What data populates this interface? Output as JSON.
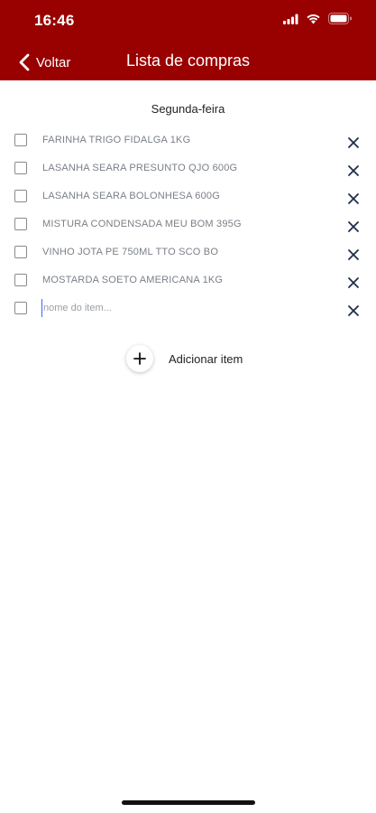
{
  "status_bar": {
    "time": "16:46",
    "icons": [
      "signal-icon",
      "wifi-icon",
      "battery-icon"
    ]
  },
  "header": {
    "back_label": "Voltar",
    "title": "Lista de compras",
    "background_color": "#990000"
  },
  "list": {
    "day": "Segunda-feira",
    "items": [
      {
        "label": "FARINHA TRIGO FIDALGA 1KG",
        "checked": false
      },
      {
        "label": "LASANHA SEARA PRESUNTO QJO 600G",
        "checked": false
      },
      {
        "label": "LASANHA SEARA BOLONHESA 600G",
        "checked": false
      },
      {
        "label": "MISTURA CONDENSADA MEU BOM 395G",
        "checked": false
      },
      {
        "label": "VINHO JOTA PE 750ML TTO SCO BO",
        "checked": false
      },
      {
        "label": "MOSTARDA SOETO AMERICANA 1KG",
        "checked": false
      }
    ],
    "new_item_placeholder": "nome do item..."
  },
  "actions": {
    "add_item_label": "Adicionar item"
  }
}
